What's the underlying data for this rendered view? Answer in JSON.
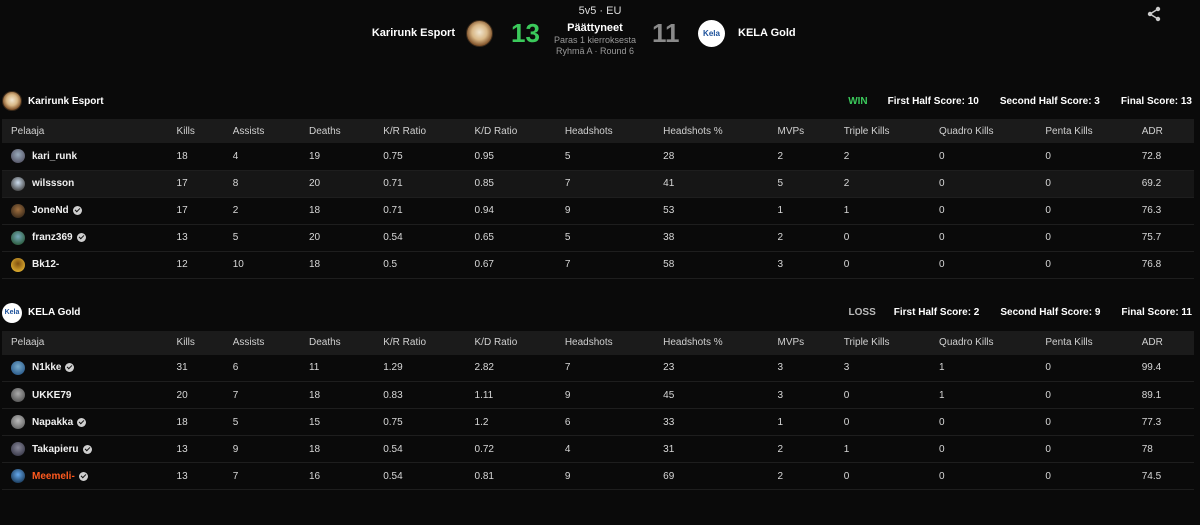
{
  "header": {
    "format": "5v5 · EU",
    "status": "Päättyneet",
    "best_of": "Paras 1 kierroksesta",
    "group_round": "Ryhmä A · Round 6",
    "team_left": {
      "name": "Karirunk Esport",
      "score": "13"
    },
    "team_right": {
      "name": "KELA Gold",
      "score": "11",
      "logo_text": "Kela"
    },
    "share_icon": "share-icon"
  },
  "columns": [
    "Pelaaja",
    "Kills",
    "Assists",
    "Deaths",
    "K/R Ratio",
    "K/D Ratio",
    "Headshots",
    "Headshots %",
    "MVPs",
    "Triple Kills",
    "Quadro Kills",
    "Penta Kills",
    "ADR"
  ],
  "teams": [
    {
      "name": "Karirunk Esport",
      "result": "WIN",
      "first_half": "First Half Score: 10",
      "second_half": "Second Half Score: 3",
      "final": "Final Score: 13",
      "players": [
        {
          "name": "kari_runk",
          "verified": false,
          "stats": [
            "18",
            "4",
            "19",
            "0.75",
            "0.95",
            "5",
            "28",
            "2",
            "2",
            "0",
            "0",
            "72.8"
          ]
        },
        {
          "name": "wilssson",
          "verified": false,
          "stats": [
            "17",
            "8",
            "20",
            "0.71",
            "0.85",
            "7",
            "41",
            "5",
            "2",
            "0",
            "0",
            "69.2"
          ]
        },
        {
          "name": "JoneNd",
          "verified": true,
          "stats": [
            "17",
            "2",
            "18",
            "0.71",
            "0.94",
            "9",
            "53",
            "1",
            "1",
            "0",
            "0",
            "76.3"
          ]
        },
        {
          "name": "franz369",
          "verified": true,
          "stats": [
            "13",
            "5",
            "20",
            "0.54",
            "0.65",
            "5",
            "38",
            "2",
            "0",
            "0",
            "0",
            "75.7"
          ]
        },
        {
          "name": "Bk12-",
          "verified": false,
          "stats": [
            "12",
            "10",
            "18",
            "0.5",
            "0.67",
            "7",
            "58",
            "3",
            "0",
            "0",
            "0",
            "76.8"
          ]
        }
      ]
    },
    {
      "name": "KELA Gold",
      "result": "LOSS",
      "first_half": "First Half Score: 2",
      "second_half": "Second Half Score: 9",
      "final": "Final Score: 11",
      "players": [
        {
          "name": "N1kke",
          "verified": true,
          "stats": [
            "31",
            "6",
            "11",
            "1.29",
            "2.82",
            "7",
            "23",
            "3",
            "3",
            "1",
            "0",
            "99.4"
          ]
        },
        {
          "name": "UKKE79",
          "verified": false,
          "stats": [
            "20",
            "7",
            "18",
            "0.83",
            "1.11",
            "9",
            "45",
            "3",
            "0",
            "1",
            "0",
            "89.1"
          ]
        },
        {
          "name": "Napakka",
          "verified": true,
          "stats": [
            "18",
            "5",
            "15",
            "0.75",
            "1.2",
            "6",
            "33",
            "1",
            "0",
            "0",
            "0",
            "77.3"
          ]
        },
        {
          "name": "Takapieru",
          "verified": true,
          "stats": [
            "13",
            "9",
            "18",
            "0.54",
            "0.72",
            "4",
            "31",
            "2",
            "1",
            "0",
            "0",
            "78"
          ]
        },
        {
          "name": "Meemeli-",
          "verified": true,
          "highlight": true,
          "stats": [
            "13",
            "7",
            "16",
            "0.54",
            "0.81",
            "9",
            "69",
            "2",
            "0",
            "0",
            "0",
            "74.5"
          ]
        }
      ]
    }
  ],
  "colors": {
    "win": "#3bc95b",
    "loss_score": "#8a8a8a",
    "highlight_player": "#ff5a1f"
  }
}
